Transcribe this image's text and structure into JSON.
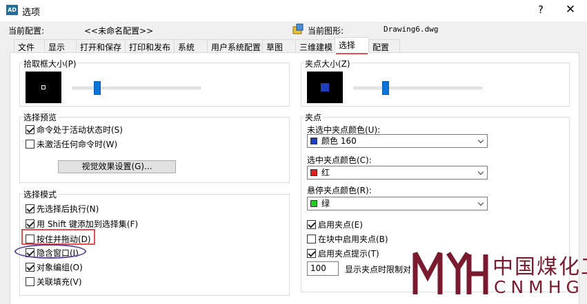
{
  "window": {
    "icon_text": "AD",
    "title": "选项",
    "help_label": "?",
    "close_label": "✕"
  },
  "profile": {
    "label": "当前配置:",
    "value": "<<未命名配置>>",
    "drawing_label": "当前图形:",
    "drawing_value": "Drawing6.dwg"
  },
  "tabs": [
    {
      "label": "文件"
    },
    {
      "label": "显示"
    },
    {
      "label": "打开和保存"
    },
    {
      "label": "打印和发布"
    },
    {
      "label": "系统"
    },
    {
      "label": "用户系统配置"
    },
    {
      "label": "草图"
    },
    {
      "label": "三维建模"
    },
    {
      "label": "选择",
      "active": true
    },
    {
      "label": "配置"
    }
  ],
  "pickbox": {
    "title": "拾取框大小(P)",
    "level": 0.2
  },
  "grip_size": {
    "title": "夹点大小(Z)",
    "level": 0.25
  },
  "preview": {
    "title": "选择预览",
    "items": [
      {
        "label": "命令处于活动状态时(S)",
        "checked": true
      },
      {
        "label": "未激活任何命令时(W)",
        "checked": false
      }
    ],
    "button_label": "视觉效果设置(G)..."
  },
  "modes": {
    "title": "选择模式",
    "items": [
      {
        "label": "先选择后执行(N)",
        "checked": true
      },
      {
        "label": "用 Shift 键添加到选择集(F)",
        "checked": true
      },
      {
        "label": "按住并拖动(D)",
        "checked": false
      },
      {
        "label": "隐含窗口(I)",
        "checked": true
      },
      {
        "label": "对象编组(O)",
        "checked": true
      },
      {
        "label": "关联填充(V)",
        "checked": false
      }
    ]
  },
  "grips": {
    "title": "夹点",
    "unselected_label": "未选中夹点颜色(U):",
    "unselected_value": "颜色 160",
    "unselected_color": "#1f3fbf",
    "selected_label": "选中夹点颜色(C):",
    "selected_value": "红",
    "selected_color": "#e02020",
    "hover_label": "悬停夹点颜色(R):",
    "hover_value": "绿",
    "hover_color": "#22cc22",
    "options": [
      {
        "label": "启用夹点(E)",
        "checked": true
      },
      {
        "label": "在块中启用夹点(B)",
        "checked": false
      },
      {
        "label": "启用夹点提示(T)",
        "checked": true
      }
    ],
    "limit_value": "100",
    "limit_label": "显示夹点时限制对"
  },
  "watermark": {
    "cn": "中国煤化工",
    "en": "CNMHG"
  }
}
